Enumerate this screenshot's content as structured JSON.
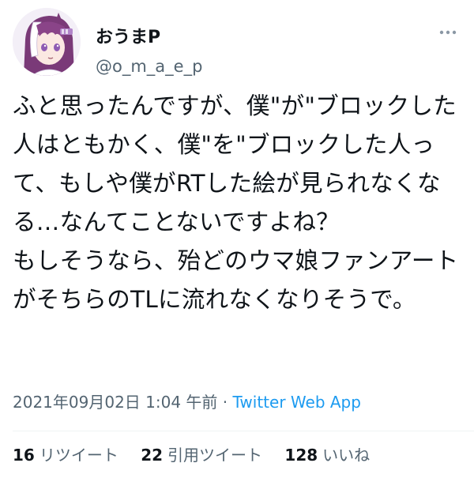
{
  "tweet": {
    "author": {
      "display_name": "おうまP",
      "handle": "@o_m_a_e_p",
      "avatar_icon": "anime-girl-avatar-icon"
    },
    "more_icon": "more-options-icon",
    "text": "ふと思ったんですが、僕\"が\"ブロックした人はともかく、僕\"を\"ブロックした人って、もしや僕がRTした絵が見られなくなる…なんてことないですよね？\nもしそうなら、殆どのウマ娘ファンアートがそちらのTLに流れなくなりそうで。",
    "timestamp": "2021年09月02日 1:04 午前",
    "separator": "·",
    "source": "Twitter Web App",
    "stats": {
      "retweets_count": "16",
      "retweets_label": "リツイート",
      "quotes_count": "22",
      "quotes_label": "引用ツイート",
      "likes_count": "128",
      "likes_label": "いいね"
    }
  },
  "colors": {
    "text": "#0f1419",
    "secondary": "#536471",
    "link": "#1d9bf0",
    "hair_purple": "#7a3a78",
    "hair_white": "#ffffff"
  }
}
